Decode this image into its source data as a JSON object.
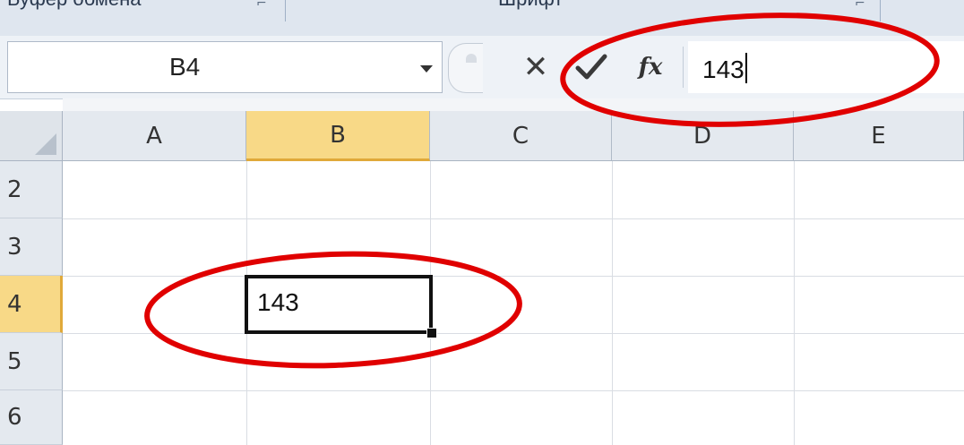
{
  "ribbon": {
    "group_left": "Буфер обмена",
    "group_mid": "Шрифт"
  },
  "formula_bar": {
    "name_box": "B4",
    "cancel_symbol": "✕",
    "enter_symbol": "✓",
    "fx_label": "fx",
    "formula_value": "143"
  },
  "columns": [
    "A",
    "B",
    "C",
    "D",
    "E"
  ],
  "active_column": "B",
  "rows": [
    "2",
    "3",
    "4",
    "5",
    "6"
  ],
  "active_row": "4",
  "active_cell": {
    "ref": "B4",
    "value": "143"
  },
  "colors": {
    "header_bg": "#e4e9ef",
    "active_header_bg": "#f8d987",
    "active_header_accent": "#e0a93a",
    "annotation_red": "#e00000"
  },
  "annotations": [
    {
      "shape": "ellipse",
      "target": "formula-bar-value",
      "color": "#e00000"
    },
    {
      "shape": "ellipse",
      "target": "active-cell-b4",
      "color": "#e00000"
    }
  ]
}
